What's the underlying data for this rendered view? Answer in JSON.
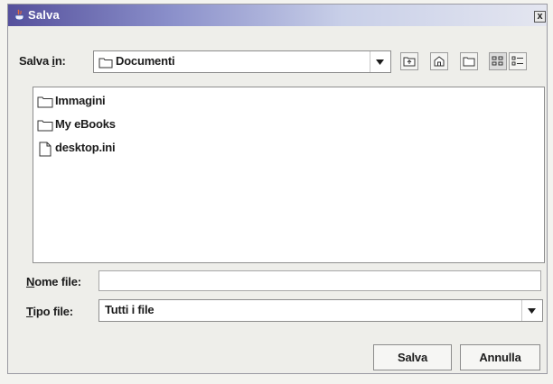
{
  "window": {
    "title": "Salva",
    "close_label": "x"
  },
  "toolbar": {
    "save_in_label_pre": "Salva ",
    "save_in_label_mn": "i",
    "save_in_label_post": "n:",
    "location": "Documenti",
    "buttons": [
      "up-one-level-icon",
      "home-icon",
      "new-folder-icon",
      "list-view-icon",
      "details-view-icon"
    ]
  },
  "files": [
    {
      "name": "Immagini",
      "type": "folder"
    },
    {
      "name": "My eBooks",
      "type": "folder"
    },
    {
      "name": "desktop.ini",
      "type": "file"
    }
  ],
  "filename": {
    "label_mn": "N",
    "label_rest": "ome file:",
    "value": ""
  },
  "filetype": {
    "label_mn": "T",
    "label_rest": "ipo file:",
    "value": "Tutti i file"
  },
  "actions": {
    "save": "Salva",
    "cancel": "Annulla"
  }
}
